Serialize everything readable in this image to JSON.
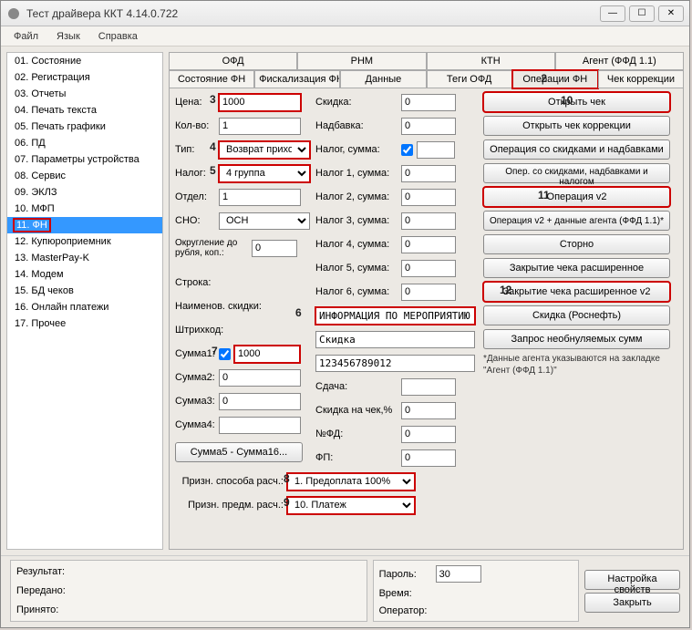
{
  "window": {
    "title": "Тест драйвера ККТ 4.14.0.722"
  },
  "menu": {
    "file": "Файл",
    "lang": "Язык",
    "help": "Справка"
  },
  "sidebar": {
    "items": [
      "01. Состояние",
      "02. Регистрация",
      "03. Отчеты",
      "04. Печать текста",
      "05. Печать графики",
      "06. ПД",
      "07. Параметры устройства",
      "08. Сервис",
      "09. ЭКЛЗ",
      "10. МФП",
      "11. ФН",
      "12. Купюроприемник",
      "13. MasterPay-K",
      "14. Модем",
      "15. БД чеков",
      "16. Онлайн платежи",
      "17. Прочее"
    ],
    "selectedIndex": 10
  },
  "tabs": {
    "row1": [
      "ОФД",
      "РНМ",
      "КТН",
      "Агент (ФФД 1.1)"
    ],
    "row2": [
      "Состояние ФН",
      "Фискализация ФН",
      "Данные",
      "Теги ОФД",
      "Операции ФН",
      "Чек коррекции"
    ],
    "activeRow2": 4
  },
  "left": {
    "price_lbl": "Цена:",
    "price": "1000",
    "qty_lbl": "Кол-во:",
    "qty": "1",
    "type_lbl": "Тип:",
    "type": "Возврат приход",
    "tax_lbl": "Налог:",
    "tax": "4 группа",
    "dept_lbl": "Отдел:",
    "dept": "1",
    "sno_lbl": "СНО:",
    "sno": "ОСН",
    "round_lbl1": "Округление до",
    "round_lbl2": "рубля, коп.:",
    "round": "0",
    "stroka_lbl": "Строка:",
    "name_lbl": "Наименов. скидки:",
    "barcode_lbl": "Штрихкод:",
    "sum1_lbl": "Сумма1:",
    "sum1": "1000",
    "sum2_lbl": "Сумма2:",
    "sum2": "0",
    "sum3_lbl": "Сумма3:",
    "sum3": "0",
    "sum4_lbl": "Сумма4:",
    "sum4": "",
    "sum5btn": "Сумма5 - Сумма16..."
  },
  "mid": {
    "skidka_lbl": "Скидка:",
    "skidka": "0",
    "nadbavka_lbl": "Надбавка:",
    "nadbavka": "0",
    "nalog_sum_lbl": "Налог, сумма:",
    "nalog_sum_chk": true,
    "nalog_sum": "",
    "n1_lbl": "Налог 1, сумма:",
    "n1": "0",
    "n2_lbl": "Налог 2, сумма:",
    "n2": "0",
    "n3_lbl": "Налог 3, сумма:",
    "n3": "0",
    "n4_lbl": "Налог 4, сумма:",
    "n4": "0",
    "n5_lbl": "Налог 5, сумма:",
    "n5": "0",
    "n6_lbl": "Налог 6, сумма:",
    "n6": "0",
    "stroka": "ИНФОРМАЦИЯ ПО МЕРОПРИЯТИЮ",
    "name": "Скидка",
    "barcode": "123456789012",
    "sdacha_lbl": "Сдача:",
    "sdacha": "",
    "skidka_chk_lbl": "Скидка на чек,%",
    "skidka_chk": "0",
    "nfd_lbl": "№ФД:",
    "nfd": "0",
    "fp_lbl": "ФП:",
    "fp": "0",
    "sposob_lbl": "Призн. способа расч.:",
    "sposob": "1. Предоплата 100%",
    "predm_lbl": "Призн. предм. расч.:",
    "predm": "10. Платеж"
  },
  "buttons": {
    "b1": "Открыть чек",
    "b2": "Открыть чек коррекции",
    "b3": "Операция со скидками и надбавками",
    "b4": "Опер. со скидками, надбавками и налогом",
    "b5": "Операция v2",
    "b6": "Операция v2 + данные агента (ФФД 1.1)*",
    "b7": "Сторно",
    "b8": "Закрытие чека расширенное",
    "b9": "Закрытие чека расширенное v2",
    "b10": "Скидка (Роснефть)",
    "b11": "Запрос необнуляемых сумм",
    "note": "*Данные агента указываются на закладке \"Агент (ФФД 1.1)\""
  },
  "bottom": {
    "result_lbl": "Результат:",
    "result": "",
    "sent_lbl": "Передано:",
    "sent": "",
    "recv_lbl": "Принято:",
    "recv": "",
    "pwd_lbl": "Пароль:",
    "pwd": "30",
    "time_lbl": "Время:",
    "time": "",
    "oper_lbl": "Оператор:",
    "oper": "",
    "props_btn": "Настройка свойств",
    "close_btn": "Закрыть"
  },
  "marks": {
    "m2": "2",
    "m3": "3",
    "m4": "4",
    "m5": "5",
    "m6": "6",
    "m7": "7",
    "m8": "8",
    "m9": "9",
    "m10": "10",
    "m11": "11",
    "m12": "12"
  }
}
